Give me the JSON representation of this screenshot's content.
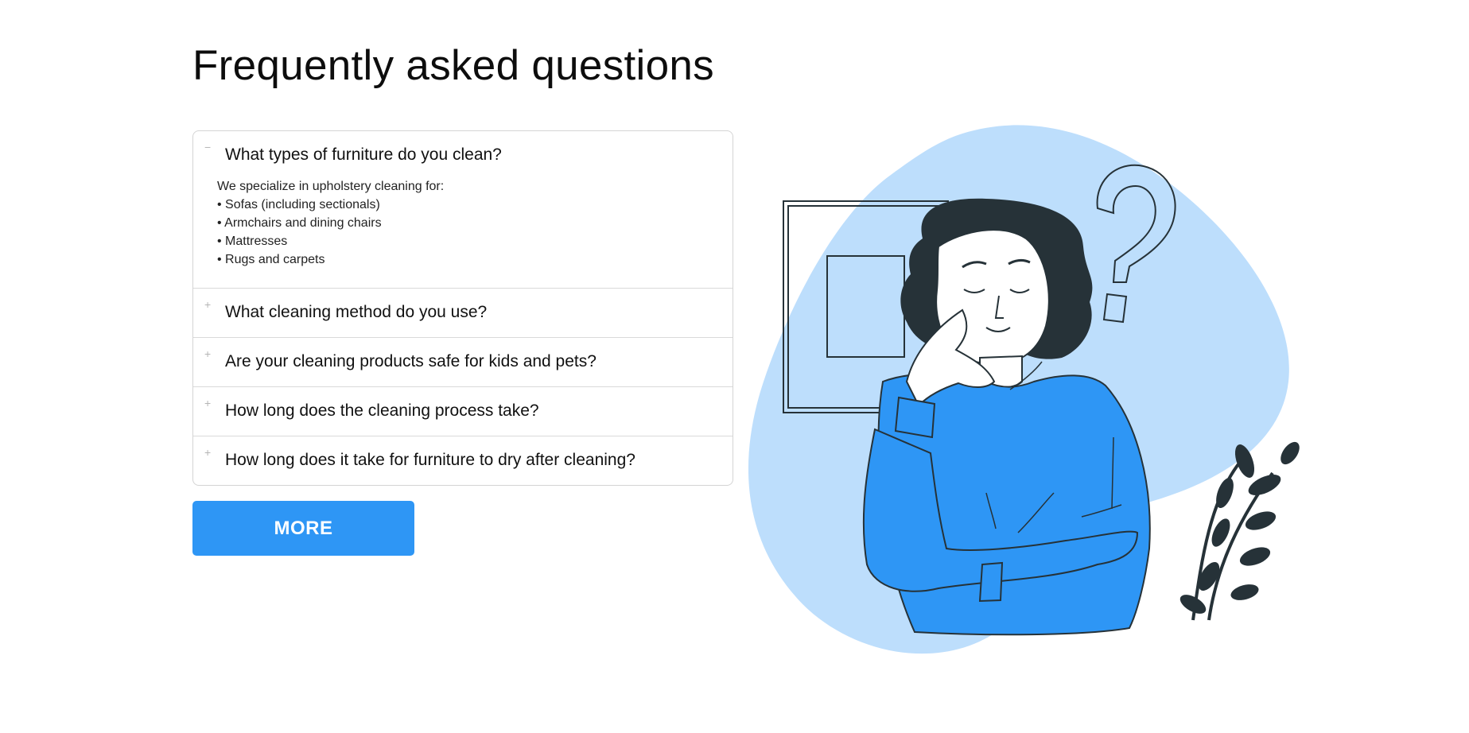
{
  "page": {
    "title": "Frequently asked questions"
  },
  "faq": {
    "items": [
      {
        "question": "What types of furniture do you clean?",
        "toggle": "−",
        "expanded": true,
        "answer": {
          "intro": "We specialize in upholstery cleaning for:",
          "bullets": [
            "• Sofas (including sectionals)",
            "• Armchairs and dining chairs",
            "• Mattresses",
            "• Rugs and carpets"
          ]
        }
      },
      {
        "question": "What cleaning method do you use?",
        "toggle": "+",
        "expanded": false
      },
      {
        "question": "Are your cleaning products safe for kids and pets?",
        "toggle": "+",
        "expanded": false
      },
      {
        "question": "How long does the cleaning process take?",
        "toggle": "+",
        "expanded": false
      },
      {
        "question": "How long does it take for furniture to dry after cleaning?",
        "toggle": "+",
        "expanded": false
      }
    ]
  },
  "more_button": {
    "label": "MORE"
  },
  "colors": {
    "accent": "#2e96f5",
    "blob": "#bddefc",
    "ink": "#263238"
  },
  "illustration": {
    "icon": "thinking-woman-illustration"
  }
}
